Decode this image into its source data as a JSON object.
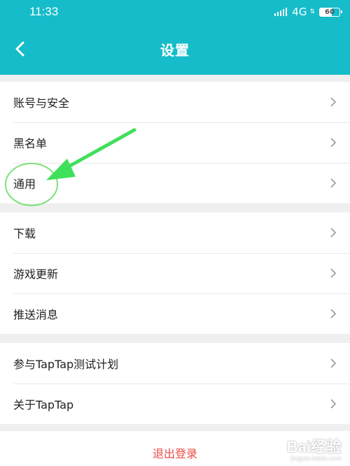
{
  "status_bar": {
    "time": "11:33",
    "network": "4G",
    "battery": "60"
  },
  "header": {
    "back_icon": "back-chevron-icon",
    "title": "设置"
  },
  "settings": {
    "group1": [
      {
        "label": "账号与安全"
      },
      {
        "label": "黑名单"
      },
      {
        "label": "通用"
      }
    ],
    "group2": [
      {
        "label": "下载"
      },
      {
        "label": "游戏更新"
      },
      {
        "label": "推送消息"
      }
    ],
    "group3": [
      {
        "label": "参与TapTap测试计划"
      },
      {
        "label": "关于TapTap"
      }
    ]
  },
  "logout": {
    "label": "退出登录"
  },
  "annotation": {
    "target": "通用",
    "arrow_color": "#3fe05a",
    "circle_color": "#7ee07a"
  },
  "watermark": {
    "mark": "Bai经验",
    "url": "jingyan.baidu.com"
  },
  "colors": {
    "header_bg": "#16bcc9",
    "page_bg": "#efefef",
    "logout_text": "#e84b47"
  }
}
